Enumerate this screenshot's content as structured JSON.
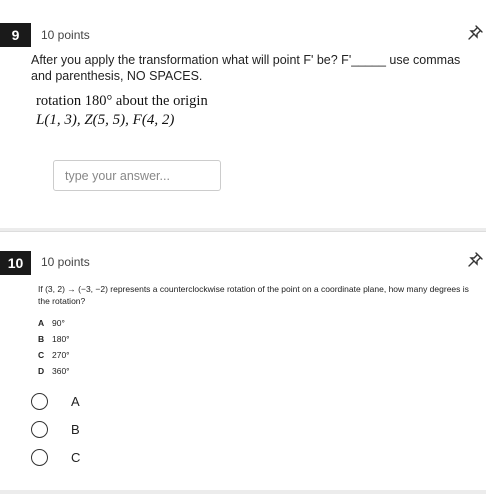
{
  "q9": {
    "number": "9",
    "points": "10 points",
    "prompt": "After you apply the transformation what will point F' be? F'_____ use commas and parenthesis, NO SPACES.",
    "image_line1": "rotation 180° about the origin",
    "image_line2": "L(1, 3), Z(5, 5), F(4, 2)",
    "answer_placeholder": "type your answer..."
  },
  "q10": {
    "number": "10",
    "points": "10 points",
    "image_text": "If (3, 2) → (−3, −2) represents a counterclockwise rotation of the point on a coordinate plane, how many degrees is the rotation?",
    "image_options": [
      {
        "letter": "A",
        "text": "90°"
      },
      {
        "letter": "B",
        "text": "180°"
      },
      {
        "letter": "C",
        "text": "270°"
      },
      {
        "letter": "D",
        "text": "360°"
      }
    ],
    "choices": [
      "A",
      "B",
      "C"
    ]
  }
}
